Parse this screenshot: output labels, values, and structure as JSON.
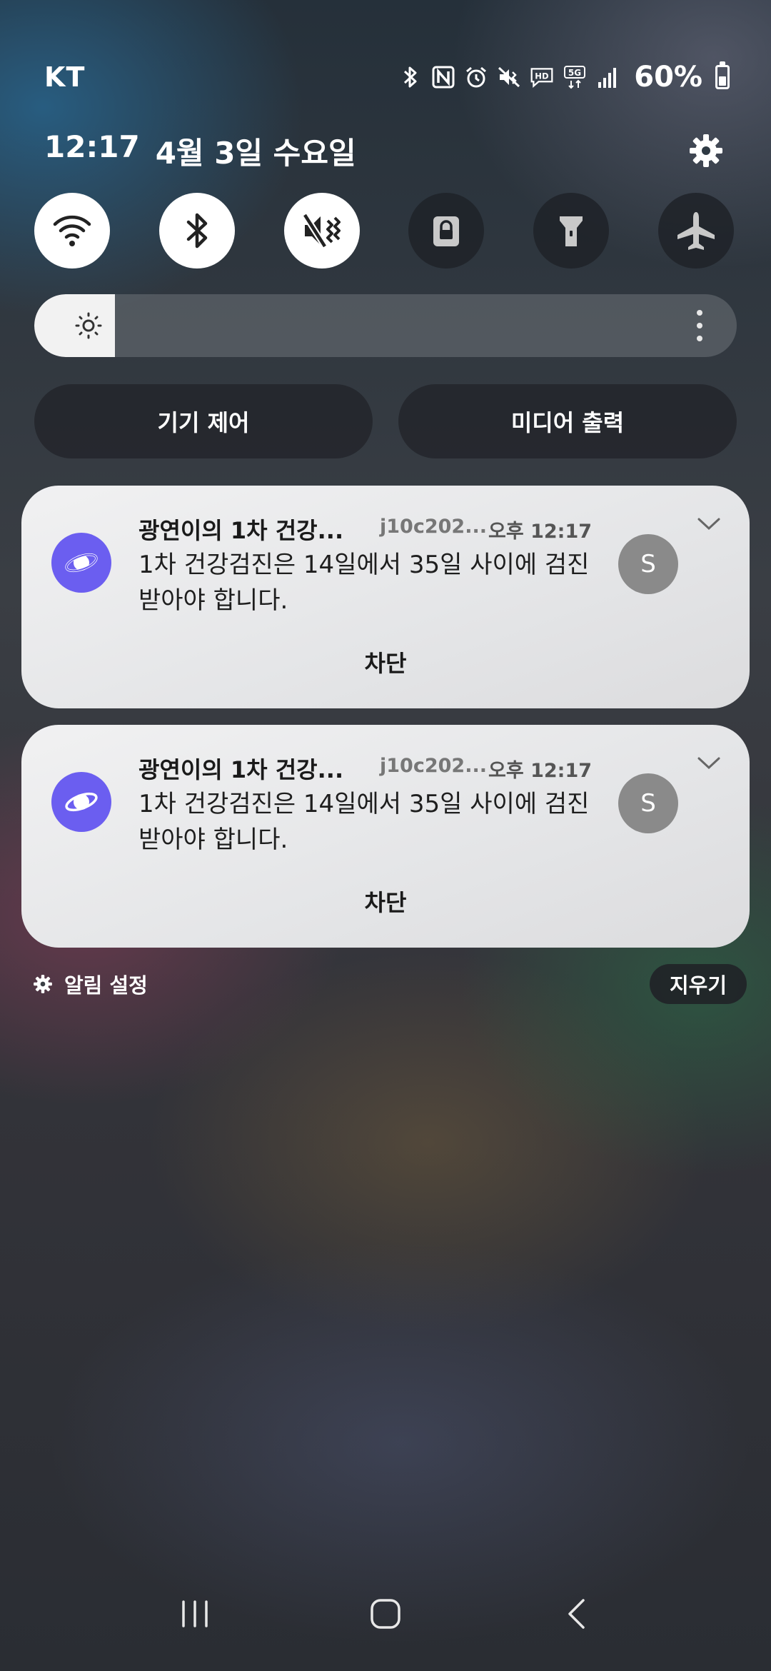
{
  "status_bar": {
    "carrier": "KT",
    "battery_percent": "60%",
    "battery_level": 0.6
  },
  "header": {
    "time": "12:17",
    "date": "4월 3일 수요일"
  },
  "quick_toggles": [
    {
      "name": "wifi",
      "state": "on"
    },
    {
      "name": "bluetooth",
      "state": "on"
    },
    {
      "name": "sound-vibrate",
      "state": "on"
    },
    {
      "name": "screen-lock",
      "state": "off"
    },
    {
      "name": "flashlight",
      "state": "off"
    },
    {
      "name": "airplane-mode",
      "state": "off"
    }
  ],
  "brightness": {
    "level": 0.115
  },
  "panel_buttons": {
    "device_control": "기기 제어",
    "media_output": "미디어 출력"
  },
  "notifications": [
    {
      "title": "광연이의 1차 건강...",
      "sender": "j10c202...",
      "time": "오후 12:17",
      "body": "1차 건강검진은 14일에서 35일 사이에 검진 받아야 합니다.",
      "avatar_letter": "S",
      "action": "차단"
    },
    {
      "title": "광연이의 1차 건강...",
      "sender": "j10c202...",
      "time": "오후 12:17",
      "body": "1차 건강검진은 14일에서 35일 사이에 검진 받아야 합니다.",
      "avatar_letter": "S",
      "action": "차단"
    }
  ],
  "footer": {
    "notification_settings": "알림 설정",
    "clear": "지우기"
  },
  "colors": {
    "app_icon": "#6b5ef0",
    "avatar": "#8a8a8a"
  }
}
